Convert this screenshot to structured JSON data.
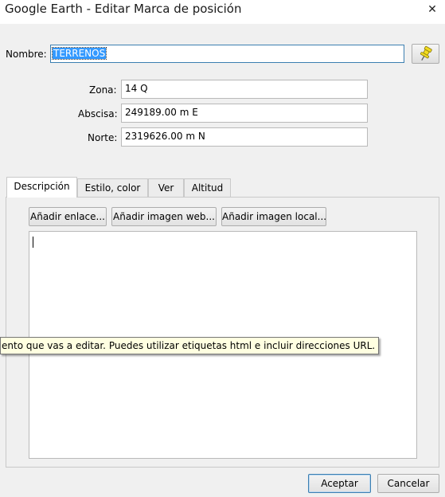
{
  "window": {
    "title": "Google Earth - Editar Marca de posición",
    "close_glyph": "✕"
  },
  "form": {
    "name_label": "Nombre:",
    "name_value": "TERRENOS",
    "zone_label": "Zona:",
    "zone_value": "14 Q",
    "abscissa_label": "Abscisa:",
    "abscissa_value": "249189.00 m E",
    "north_label": "Norte:",
    "north_value": "2319626.00 m N"
  },
  "pin_button": {
    "icon": "pushpin-icon",
    "color": "#e8d21c"
  },
  "tabs": [
    {
      "label": "Descripción",
      "active": true
    },
    {
      "label": "Estilo, color",
      "active": false
    },
    {
      "label": "Ver",
      "active": false
    },
    {
      "label": "Altitud",
      "active": false
    }
  ],
  "description_panel": {
    "add_link_label": "Añadir enlace...",
    "add_web_image_label": "Añadir imagen web...",
    "add_local_image_label": "Añadir imagen local...",
    "text_value": ""
  },
  "tooltip": {
    "text": "ento que vas a editar. Puedes utilizar etiquetas html e incluir direcciones URL."
  },
  "footer": {
    "accept_label": "Aceptar",
    "cancel_label": "Cancelar"
  },
  "colors": {
    "selection": "#3399ff",
    "focus_border": "#3c7fb1",
    "tooltip_bg": "#ffffe1"
  }
}
